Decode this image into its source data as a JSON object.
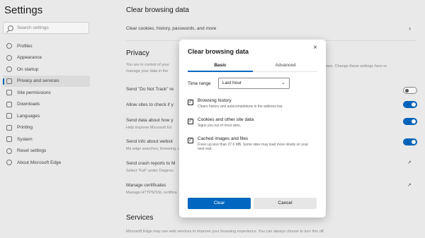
{
  "sidebar": {
    "title": "Settings",
    "search_placeholder": "Search settings",
    "items": [
      {
        "label": "Profiles",
        "icon": "profile-icon"
      },
      {
        "label": "Appearance",
        "icon": "appearance-icon"
      },
      {
        "label": "On startup",
        "icon": "power-icon"
      },
      {
        "label": "Privacy and services",
        "icon": "lock-icon",
        "active": true
      },
      {
        "label": "Site permissions",
        "icon": "permissions-icon"
      },
      {
        "label": "Downloads",
        "icon": "download-icon"
      },
      {
        "label": "Languages",
        "icon": "language-icon"
      },
      {
        "label": "Printing",
        "icon": "printer-icon"
      },
      {
        "label": "System",
        "icon": "system-icon"
      },
      {
        "label": "Reset settings",
        "icon": "reset-icon"
      },
      {
        "label": "About Microsoft Edge",
        "icon": "edge-icon"
      }
    ]
  },
  "main": {
    "clear_title": "Clear browsing data",
    "clear_row": "Clear cookies, history, passwords, and more",
    "privacy_title": "Privacy",
    "privacy_desc_left": "You are in control of your",
    "privacy_desc_left2": "manage your data in the",
    "privacy_desc_right": "tunes. Change these settings here or",
    "dnt": "Send \"Do Not Track\" re",
    "allow_sites": "Allow sites to check if y",
    "send_data": "Send data about how y",
    "send_data_sub": "Help improve Microsoft Ed",
    "send_info": "Send info about websit",
    "send_info_sub": "Ms edge searches, browsing, a",
    "crash": "Send crash reports to M",
    "crash_sub": "Select \"Full\" under Diagnos",
    "certs": "Manage certificates",
    "certs_sub": "Manage HTTPS/SSL certifica",
    "services_title": "Services",
    "services_desc": "Microsoft Edge may use web services to improve your browsing experience. You can always choose to turn this off."
  },
  "dialog": {
    "title": "Clear browsing data",
    "close": "×",
    "tabs": [
      "Basic",
      "Advanced"
    ],
    "time_range_label": "Time range",
    "time_range_value": "Last hour",
    "options": [
      {
        "title": "Browsing history",
        "desc": "Clears history and autocompletions in the address bar.",
        "checked": true
      },
      {
        "title": "Cookies and other site data",
        "desc": "Signs you out of most sites.",
        "checked": true
      },
      {
        "title": "Cached images and files",
        "desc": "Frees up less than 37.6 MB. Some sites may load more slowly on your next visit.",
        "checked": true
      }
    ],
    "clear_button": "Clear",
    "cancel_button": "Cancel"
  },
  "colors": {
    "accent": "#0067c0"
  }
}
